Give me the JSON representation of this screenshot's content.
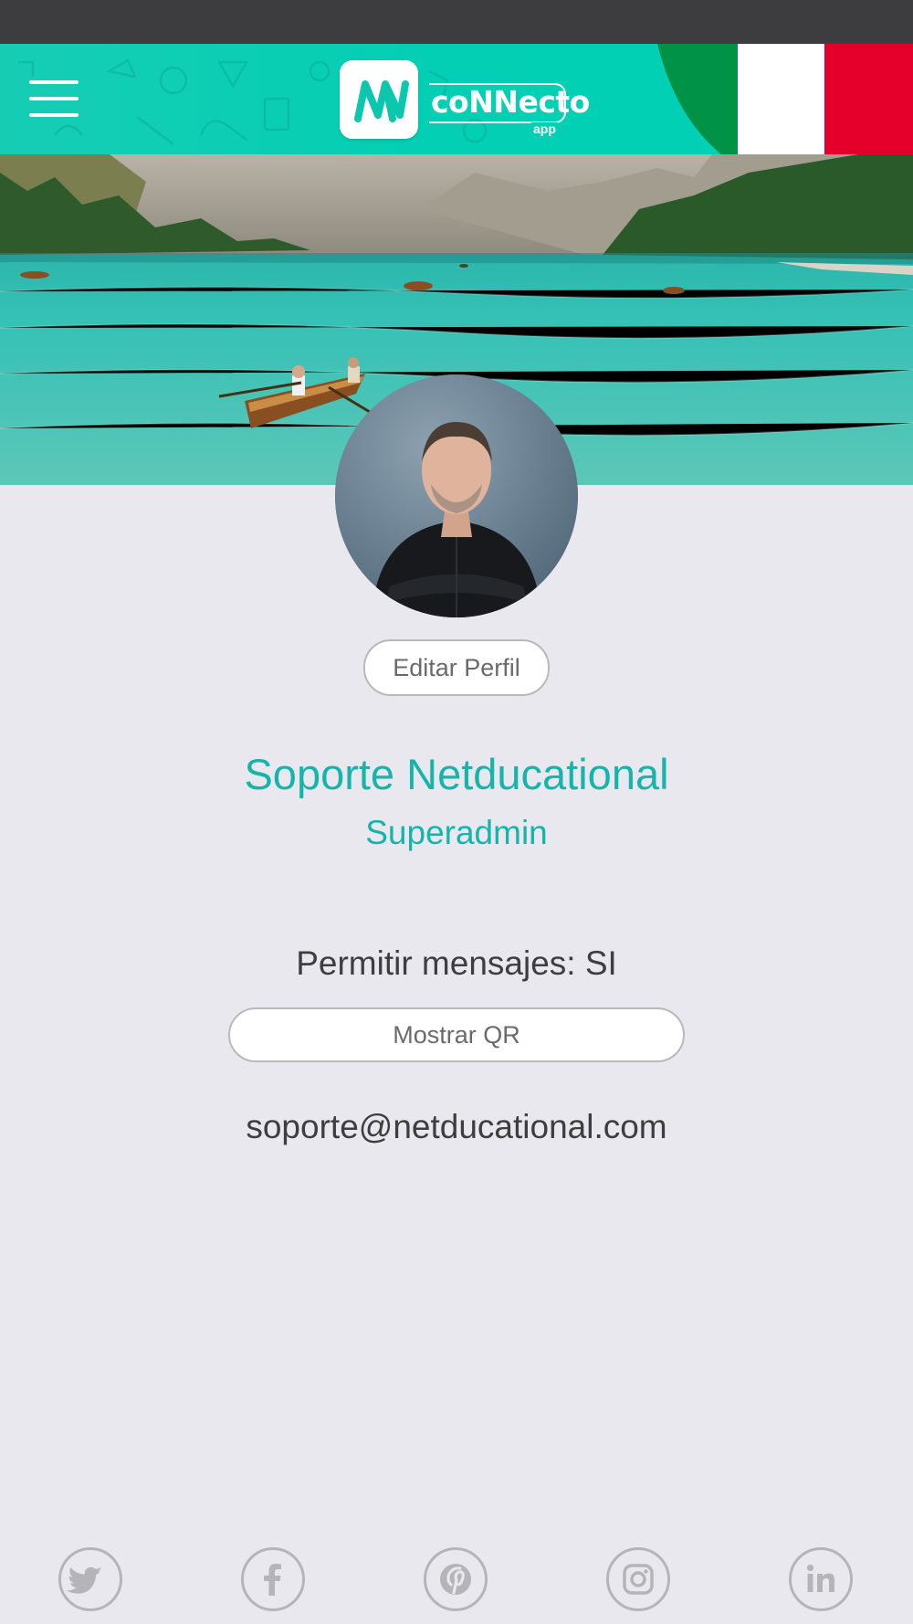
{
  "header": {
    "brand_text": "coNNecto",
    "brand_sub": "app",
    "menu_icon": "hamburger-menu-icon",
    "flag_colors": [
      "#009246",
      "#ffffff",
      "#e4002b"
    ]
  },
  "profile": {
    "edit_label": "Editar Perfil",
    "name": "Soporte Netducational",
    "role": "Superadmin",
    "allow_messages": "Permitir mensajes: SI",
    "qr_label": "Mostrar QR",
    "email": "soporte@netducational.com"
  },
  "social": [
    {
      "icon": "twitter-icon"
    },
    {
      "icon": "facebook-icon"
    },
    {
      "icon": "pinterest-icon"
    },
    {
      "icon": "instagram-icon"
    },
    {
      "icon": "linkedin-icon"
    }
  ],
  "colors": {
    "accent": "#16b5ab",
    "header": "#02cfb4",
    "background": "#e9e8ee",
    "statusbar": "#3d3d3f"
  }
}
